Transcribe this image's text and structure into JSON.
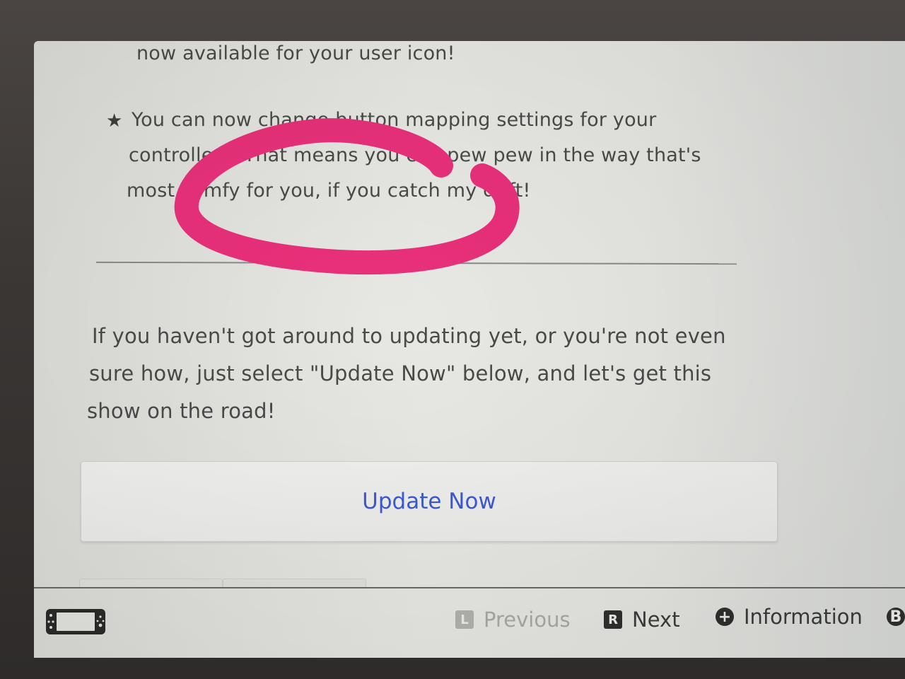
{
  "content": {
    "paragraph_top_tail": "now available for your user icon!",
    "bullet_lines": [
      "You can now change button mapping settings for your",
      "controllers. That means you can pew pew in the way that's",
      "most comfy for you, if you catch my drift!"
    ],
    "update_paragraph_lines": [
      "If you haven't got around to updating yet, or you're not even",
      "sure how, just select \"Update Now\" below, and let's get this",
      "show on the road!"
    ],
    "update_button_label": "Update Now"
  },
  "footer": {
    "previous_key": "L",
    "previous_label": "Previous",
    "next_key": "R",
    "next_label": "Next",
    "info_key": "+",
    "info_label": "Information",
    "back_key": "B"
  },
  "colors": {
    "link_blue": "#3d5ad0",
    "marker_pink": "#e8307a"
  },
  "icons": {
    "bullet": "star-icon",
    "console": "console-mode-icon"
  }
}
